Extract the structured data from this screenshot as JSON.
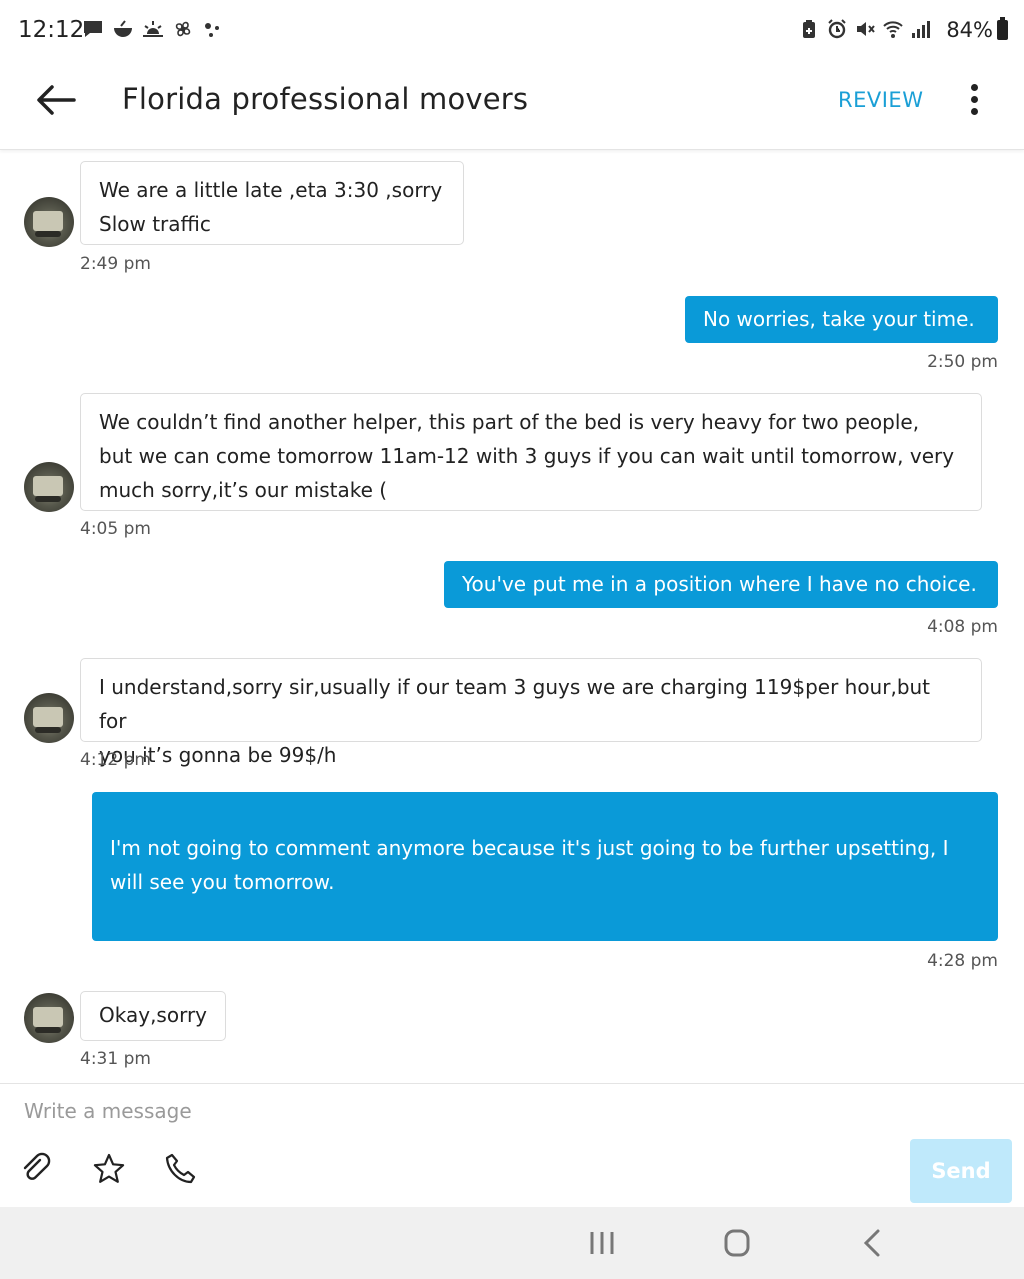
{
  "status_bar": {
    "time": "12:12",
    "battery": "84%",
    "left_icons": [
      "message-icon",
      "bowl-icon",
      "sunrise-icon",
      "fan-icon",
      "dots-icon"
    ],
    "right_icons": [
      "battery-saver-icon",
      "alarm-icon",
      "mute-icon",
      "wifi-icon",
      "signal-icon"
    ]
  },
  "header": {
    "title": "Florida professional movers",
    "review_label": "REVIEW"
  },
  "messages": [
    {
      "direction": "in",
      "lines": [
        "We are a little late ,eta 3:30 ,sorry",
        "Slow traffic"
      ],
      "time": "2:49 pm"
    },
    {
      "direction": "out",
      "lines": [
        "No worries, take your time."
      ],
      "time": "2:50 pm"
    },
    {
      "direction": "in",
      "lines": [
        "We couldn’t find another helper, this part of the bed is very heavy for two people,",
        "but we can come tomorrow 11am-12 with 3 guys if you can wait until tomorrow, very",
        "much sorry,it’s our mistake ("
      ],
      "time": "4:05 pm"
    },
    {
      "direction": "out",
      "lines": [
        "You've put me in a position where I have no choice."
      ],
      "time": "4:08 pm"
    },
    {
      "direction": "in",
      "lines": [
        "I understand,sorry sir,usually if our team 3 guys we are charging 119$per hour,but for",
        "you it’s gonna be 99$/h"
      ],
      "time": "4:12 pm"
    },
    {
      "direction": "out",
      "lines": [
        "I'm not going to comment anymore because it's just going to be further upsetting, I",
        "will see you tomorrow."
      ],
      "time": "4:28 pm"
    },
    {
      "direction": "in",
      "lines": [
        "Okay,sorry"
      ],
      "time": "4:31 pm"
    }
  ],
  "composer": {
    "placeholder": "Write a message",
    "value": "",
    "send_label": "Send",
    "tools": [
      "attach-icon",
      "star-icon",
      "phone-icon"
    ]
  },
  "colors": {
    "accent": "#0a9ad8",
    "review": "#1a9fd6",
    "send_disabled": "#bfe9fb"
  }
}
